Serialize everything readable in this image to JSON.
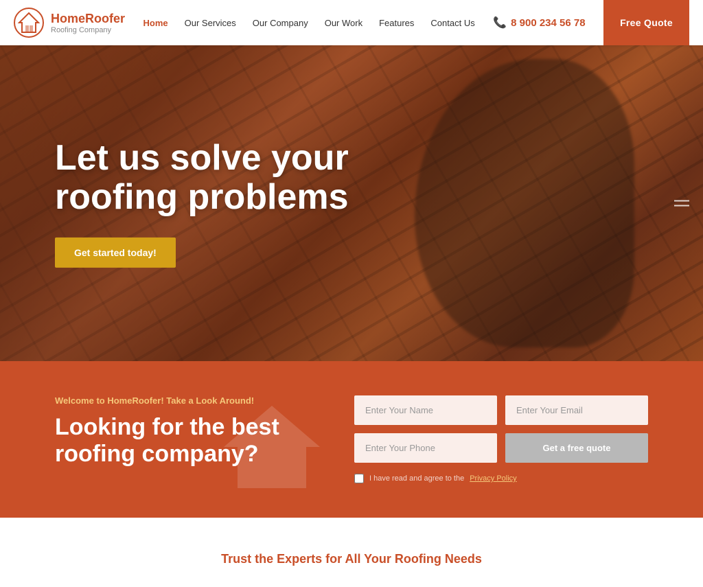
{
  "header": {
    "logo_title": "HomeRoofer",
    "logo_subtitle": "Roofing Company",
    "nav": [
      {
        "label": "Home",
        "active": true
      },
      {
        "label": "Our Services",
        "active": false
      },
      {
        "label": "Our Company",
        "active": false
      },
      {
        "label": "Our Work",
        "active": false
      },
      {
        "label": "Features",
        "active": false
      },
      {
        "label": "Contact Us",
        "active": false
      }
    ],
    "phone": "8 900 234 56 78",
    "free_quote_label": "Free Quote"
  },
  "hero": {
    "title": "Let us solve your roofing problems",
    "cta_label": "Get started today!"
  },
  "orange_section": {
    "subtitle": "Welcome to HomeRoofer! Take a Look Around!",
    "title": "Looking for the best roofing company?",
    "form": {
      "name_placeholder": "Enter Your Name",
      "email_placeholder": "Enter Your Email",
      "phone_placeholder": "Enter Your Phone",
      "quote_button_label": "Get a free quote",
      "privacy_text": "I have read and agree to the ",
      "privacy_link_text": "Privacy Policy"
    }
  },
  "bottom_section": {
    "tagline": "Trust the Experts for All Your Roofing Needs"
  }
}
